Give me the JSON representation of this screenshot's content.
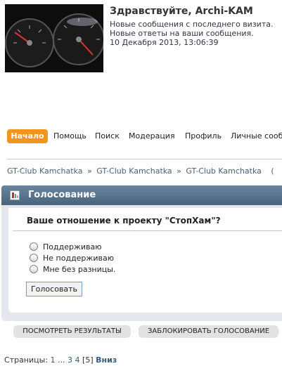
{
  "header": {
    "greeting": "Здравствуйте, Archi-KAM",
    "new_since_visit": "Новые сообщения с последнего визита.",
    "new_replies": "Новые ответы на ваши сообщения.",
    "datetime": "10 Декабря 2013, 13:06:39"
  },
  "menu": {
    "items": [
      "Начало",
      "Помощь",
      "Поиск",
      "Модерация",
      "Профиль",
      "Личные сооб"
    ],
    "active": "Начало"
  },
  "breadcrumb": [
    "GT-Club Kamchatka",
    "GT-Club Kamchatka",
    "GT-Club Kamchatka",
    "("
  ],
  "breadcrumb_sep": "»",
  "poll": {
    "title": "Голосование",
    "question": "Ваше отношение к проекту \"СтопХам\"?",
    "options": [
      "Поддерживаю",
      "Не поддерживаю",
      "Мне без разницы."
    ],
    "vote_button": "Голосовать",
    "colors": {
      "header": "#5a758e",
      "panel": "#e4e8ec"
    }
  },
  "actions": {
    "view_results": "ПОСМОТРЕТЬ РЕЗУЛЬТАТЫ",
    "lock_poll": "ЗАБЛОКИРОВАТЬ ГОЛОСОВАНИЕ"
  },
  "pagination": {
    "label": "Страницы:",
    "first": "1",
    "ellipsis": "...",
    "pages": [
      "3",
      "4"
    ],
    "current": "[5]",
    "down": "Вниз"
  },
  "accent": "#f1951d"
}
